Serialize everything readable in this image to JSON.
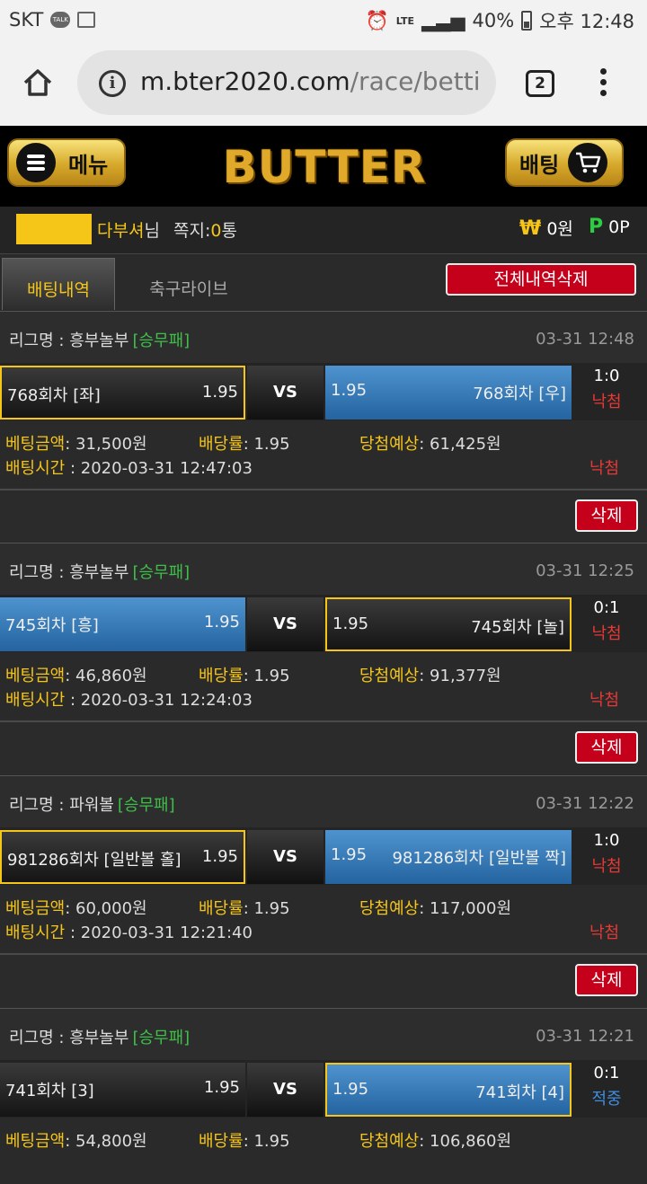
{
  "status_bar": {
    "carrier": "SKT",
    "talk": "TALK",
    "network": "LTE",
    "battery": "40%",
    "time": "오후 12:48"
  },
  "browser": {
    "url_main": "m.bter2020.com",
    "url_path": "/race/betti",
    "tab_count": "2"
  },
  "header": {
    "menu_label": "메뉴",
    "logo": "BUTTER",
    "bet_label": "배팅"
  },
  "user": {
    "name": "다부셔",
    "suffix": "님",
    "memo_label": "쪽지:",
    "memo_count": "0",
    "memo_unit": "통",
    "money_symbol": "₩",
    "money": "0원",
    "point_symbol": "P",
    "point": "0P"
  },
  "tabs": {
    "history": "배팅내역",
    "live": "축구라이브",
    "delete_all": "전체내역삭제"
  },
  "labels": {
    "league_prefix": "리그명 : ",
    "vs": "VS",
    "amount": "베팅금액",
    "rate": "배당률",
    "expected": "당첨예상",
    "bet_time": "배팅시간",
    "delete": "삭제",
    "colon": ": "
  },
  "bets": [
    {
      "league": "흥부놀부",
      "type": "[승무패]",
      "time": "03-31 12:48",
      "home": "768회차 [좌]",
      "home_odds": "1.95",
      "away": "768회차 [우]",
      "away_odds": "1.95",
      "score": "1:0",
      "result": "낙첨",
      "amount": "31,500원",
      "rate": "1.95",
      "expected": "61,425원",
      "bet_time": "2020-03-31 12:47:03",
      "result_final": "낙첨"
    },
    {
      "league": "흥부놀부",
      "type": "[승무패]",
      "time": "03-31 12:25",
      "home": "745회차 [흥]",
      "home_odds": "1.95",
      "away": "745회차 [놀]",
      "away_odds": "1.95",
      "score": "0:1",
      "result": "낙첨",
      "amount": "46,860원",
      "rate": "1.95",
      "expected": "91,377원",
      "bet_time": "2020-03-31 12:24:03",
      "result_final": "낙첨"
    },
    {
      "league": "파워볼",
      "type": "[승무패]",
      "time": "03-31 12:22",
      "home": "981286회차 [일반볼 홀]",
      "home_odds": "1.95",
      "away": "981286회차 [일반볼 짝]",
      "away_odds": "1.95",
      "score": "1:0",
      "result": "낙첨",
      "amount": "60,000원",
      "rate": "1.95",
      "expected": "117,000원",
      "bet_time": "2020-03-31 12:21:40",
      "result_final": "낙첨"
    },
    {
      "league": "흥부놀부",
      "type": "[승무패]",
      "time": "03-31 12:21",
      "home": "741회차 [3]",
      "home_odds": "1.95",
      "away": "741회차 [4]",
      "away_odds": "1.95",
      "score": "0:1",
      "result": "적중",
      "amount": "54,800원",
      "rate": "1.95",
      "expected": "106,860원"
    }
  ]
}
